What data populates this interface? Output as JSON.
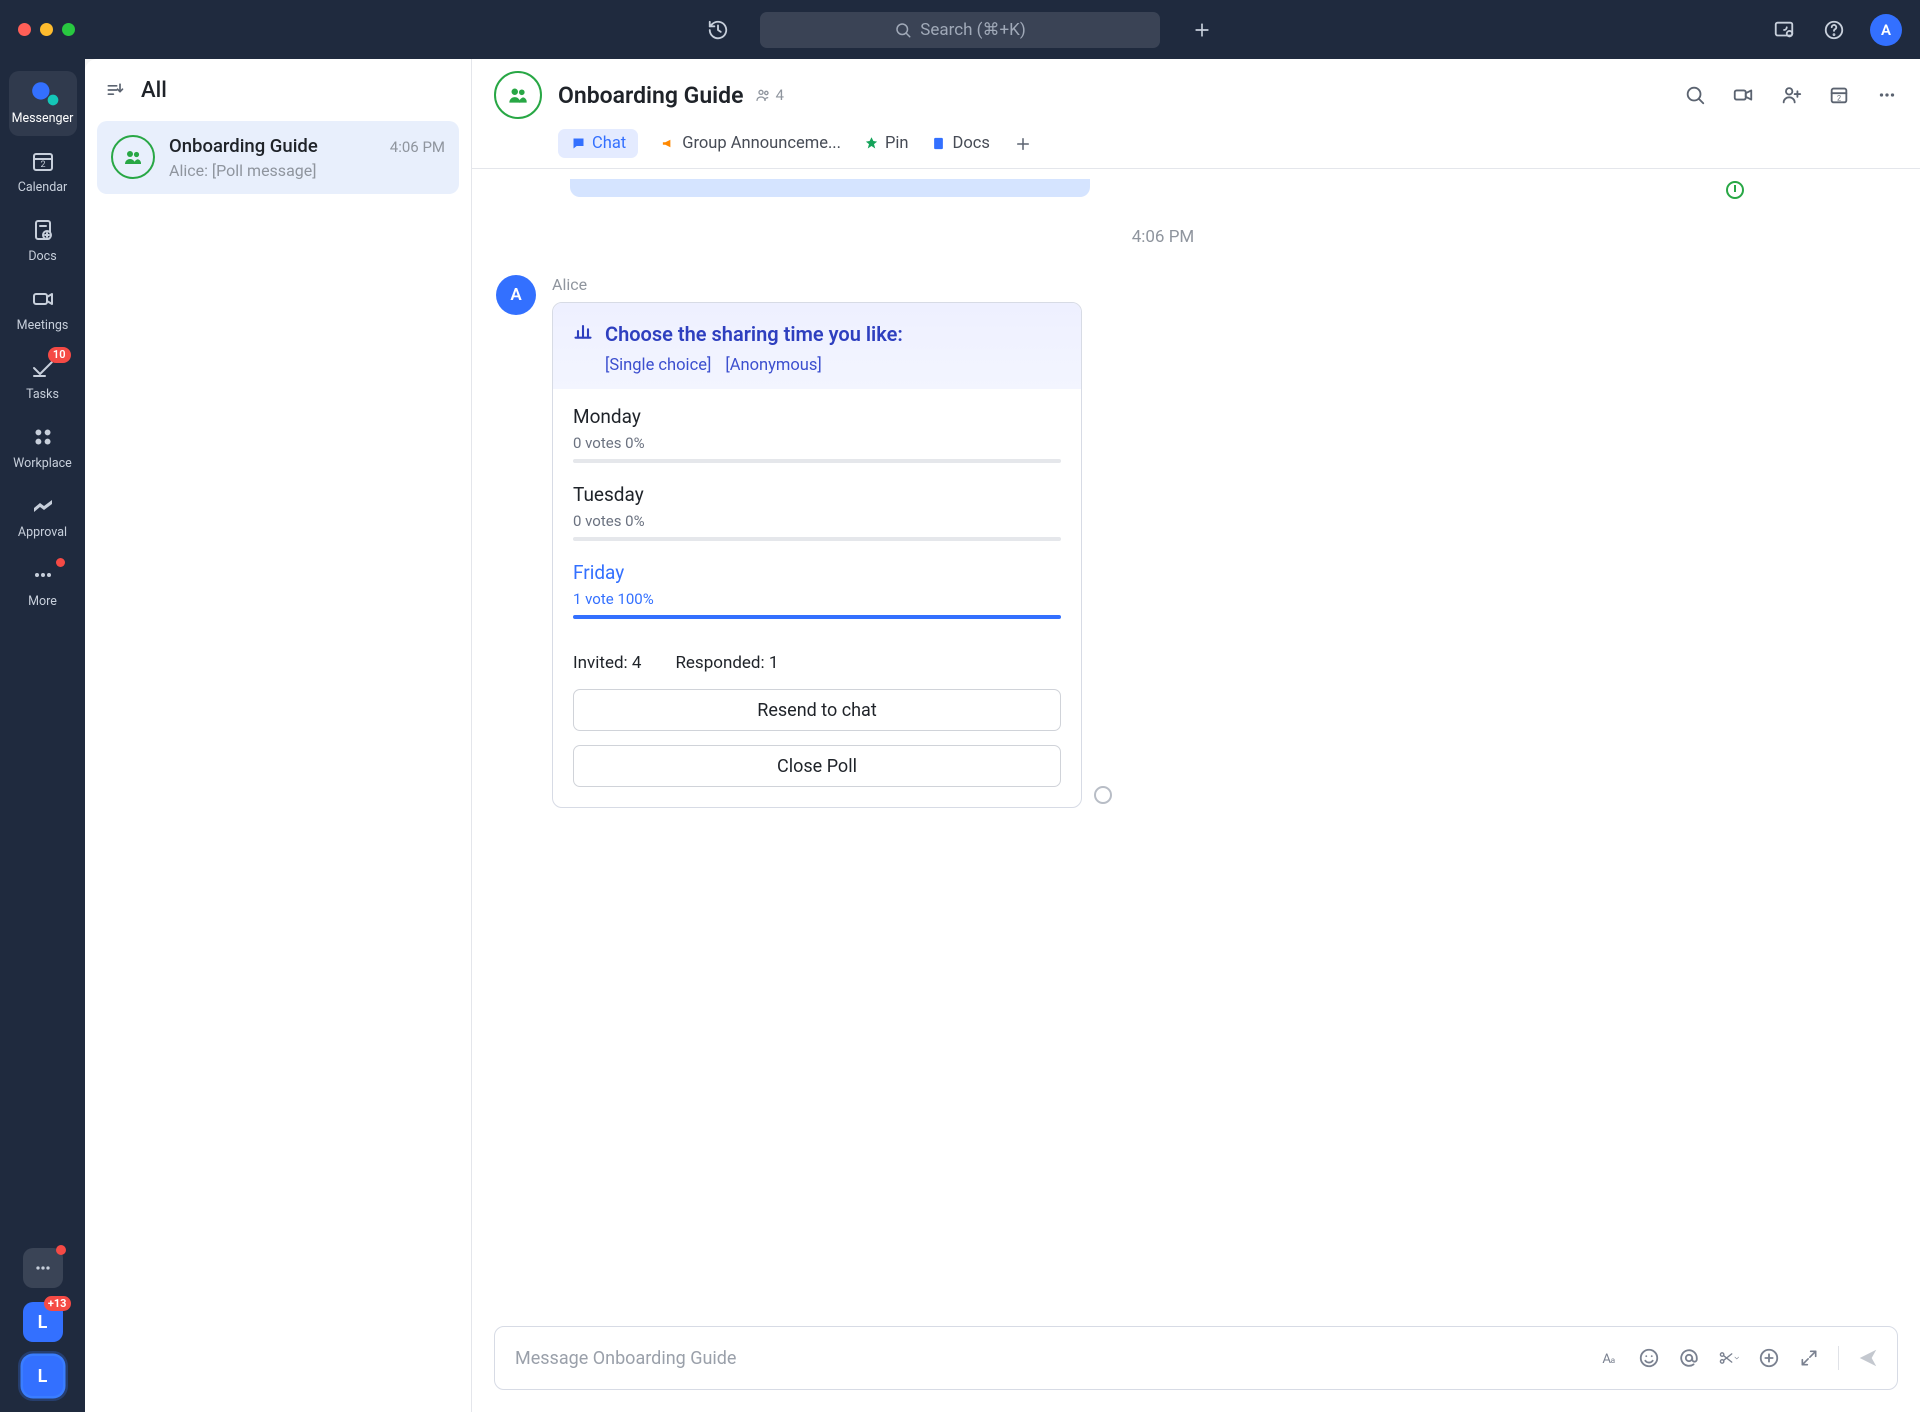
{
  "titlebar": {
    "search_placeholder": "Search (⌘+K)",
    "avatar_initial": "A"
  },
  "nav": {
    "items": [
      {
        "label": "Messenger"
      },
      {
        "label": "Calendar"
      },
      {
        "label": "Docs"
      },
      {
        "label": "Meetings"
      },
      {
        "label": "Tasks",
        "badge": "10"
      },
      {
        "label": "Workplace"
      },
      {
        "label": "Approval"
      },
      {
        "label": "More"
      }
    ],
    "bottom": {
      "switcher1_badge": "+13",
      "switcher1_initial": "L",
      "switcher2_initial": "L"
    }
  },
  "list": {
    "header": "All",
    "items": [
      {
        "title": "Onboarding Guide",
        "time": "4:06 PM",
        "preview": "Alice: [Poll message]"
      }
    ]
  },
  "chat": {
    "title": "Onboarding Guide",
    "member_count": "4",
    "tabs": {
      "chat": "Chat",
      "announce": "Group Announceme...",
      "pin": "Pin",
      "docs": "Docs"
    },
    "time_separator": "4:06 PM",
    "message": {
      "sender": "Alice",
      "sender_initial": "A",
      "poll": {
        "title": "Choose the sharing time you like:",
        "tags": [
          "[Single choice]",
          "[Anonymous]"
        ],
        "options": [
          {
            "name": "Monday",
            "stat": "0 votes 0%",
            "pct": 0,
            "selected": false
          },
          {
            "name": "Tuesday",
            "stat": "0 votes 0%",
            "pct": 0,
            "selected": false
          },
          {
            "name": "Friday",
            "stat": "1 vote 100%",
            "pct": 100,
            "selected": true
          }
        ],
        "invited_label": "Invited: 4",
        "responded_label": "Responded: 1",
        "resend_btn": "Resend to chat",
        "close_btn": "Close Poll"
      }
    },
    "composer_placeholder": "Message Onboarding Guide"
  }
}
